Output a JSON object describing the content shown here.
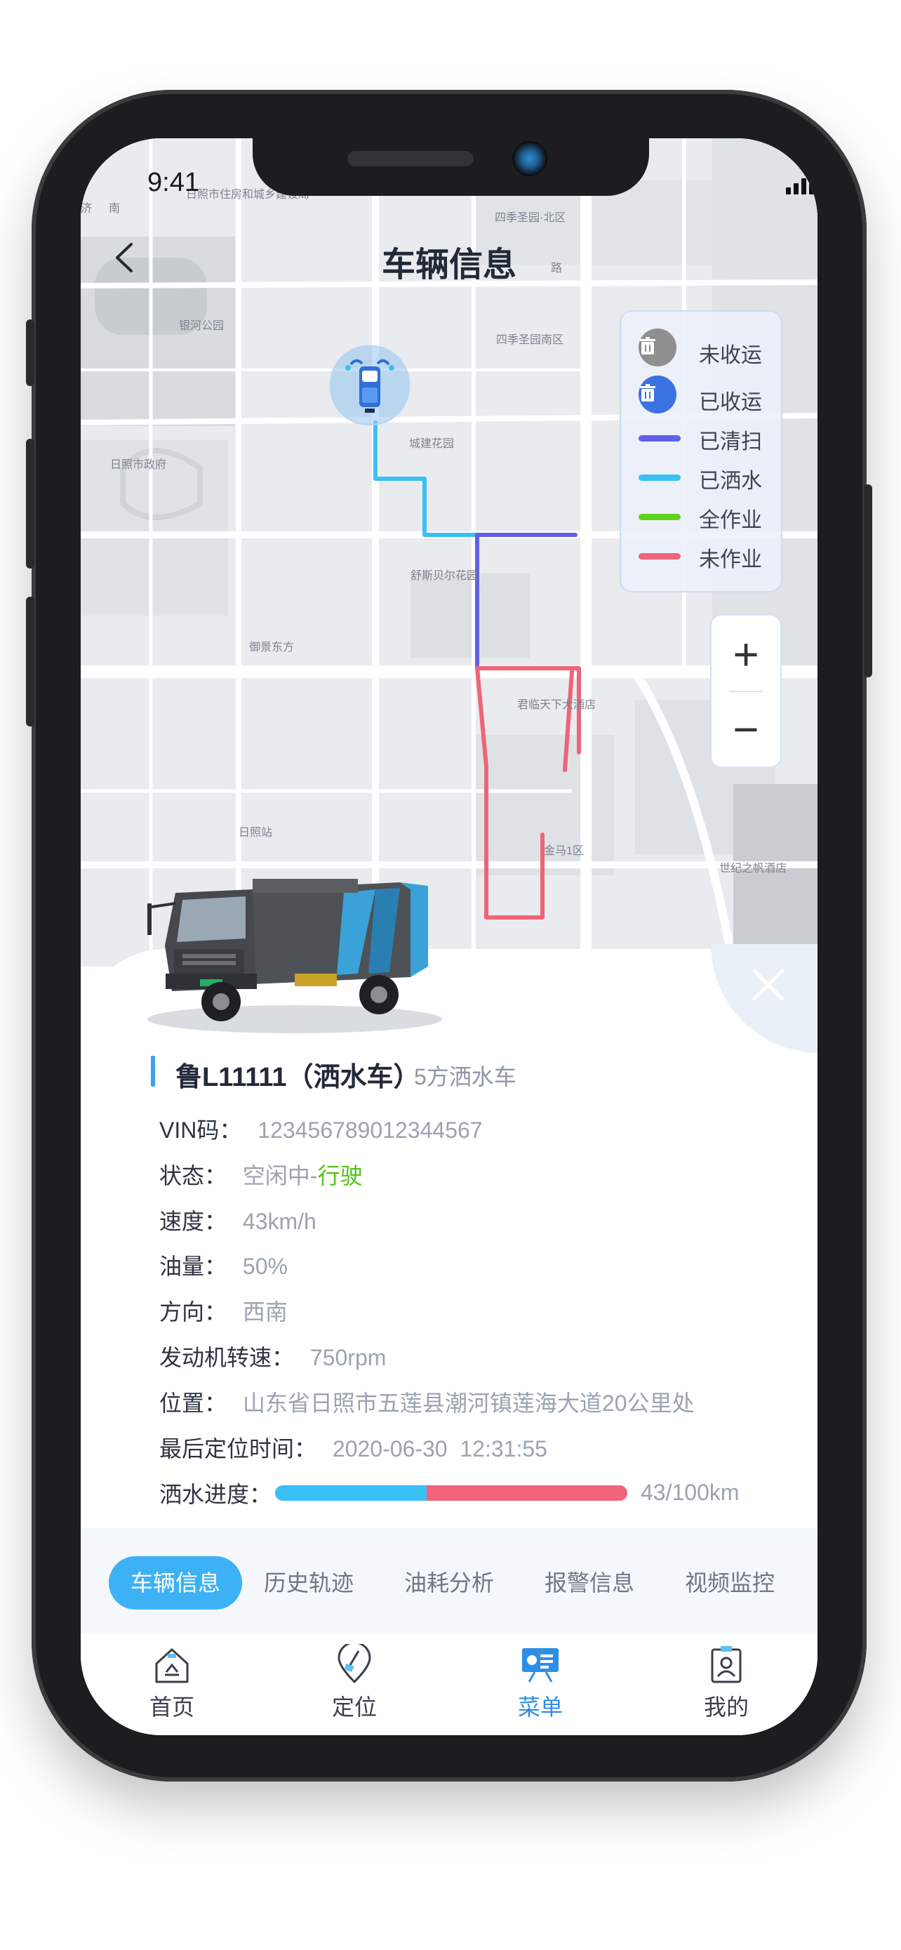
{
  "status_bar": {
    "time": "9:41"
  },
  "header": {
    "title": "车辆信息"
  },
  "map": {
    "labels": [
      "日照市住房和城乡建设局",
      "四季圣园·北区",
      "银河公园",
      "四季圣园南区",
      "日照市政府",
      "城建花园",
      "舒斯贝尔花园",
      "御景东方",
      "君临天下大酒店",
      "日照站",
      "金马1区",
      "世纪之帆酒店",
      "济",
      "南",
      "路"
    ]
  },
  "legend": {
    "items": [
      {
        "label": "未收运",
        "kind": "dot",
        "color": "#8f8f8f"
      },
      {
        "label": "已收运",
        "kind": "dot",
        "color": "#3a73e0"
      },
      {
        "label": "已清扫",
        "kind": "line",
        "color": "#6160e6"
      },
      {
        "label": "已洒水",
        "kind": "line",
        "color": "#39c0f5"
      },
      {
        "label": "全作业",
        "kind": "line",
        "color": "#5fd21a"
      },
      {
        "label": "未作业",
        "kind": "line",
        "color": "#ef6478"
      }
    ]
  },
  "zoom": {
    "plus": "+",
    "minus": "−"
  },
  "vehicle": {
    "plate": "鲁L11111（洒水车）",
    "type": "5方洒水车",
    "vin_label": "VIN码：",
    "vin": "123456789012344567",
    "status_label": "状态：",
    "status_value": "空闲中-",
    "status_highlight": "行驶",
    "speed_label": "速度：",
    "speed": "43km/h",
    "fuel_label": "油量：",
    "fuel": "50%",
    "direction_label": "方向：",
    "direction": "西南",
    "rpm_label": "发动机转速：",
    "rpm": "750rpm",
    "location_label": "位置：",
    "location": "山东省日照市五莲县潮河镇莲海大道20公里处",
    "last_time_label": "最后定位时间：",
    "last_time": "2020-06-30  12:31:55",
    "progress_label": "洒水进度：",
    "progress_text": "43/100km",
    "progress_fraction": 0.43
  },
  "tabs": [
    {
      "label": "车辆信息",
      "active": true
    },
    {
      "label": "历史轨迹",
      "active": false
    },
    {
      "label": "油耗分析",
      "active": false
    },
    {
      "label": "报警信息",
      "active": false
    },
    {
      "label": "视频监控",
      "active": false
    }
  ],
  "nav": [
    {
      "label": "首页",
      "icon": "home-recycle-icon",
      "active": false
    },
    {
      "label": "定位",
      "icon": "location-broom-icon",
      "active": false
    },
    {
      "label": "菜单",
      "icon": "menu-board-icon",
      "active": true
    },
    {
      "label": "我的",
      "icon": "profile-badge-icon",
      "active": false
    }
  ],
  "colors": {
    "accent": "#3db1f5",
    "nav_active": "#2e8ee6",
    "water_progress": "#39c0f5",
    "remaining": "#f1647a"
  }
}
